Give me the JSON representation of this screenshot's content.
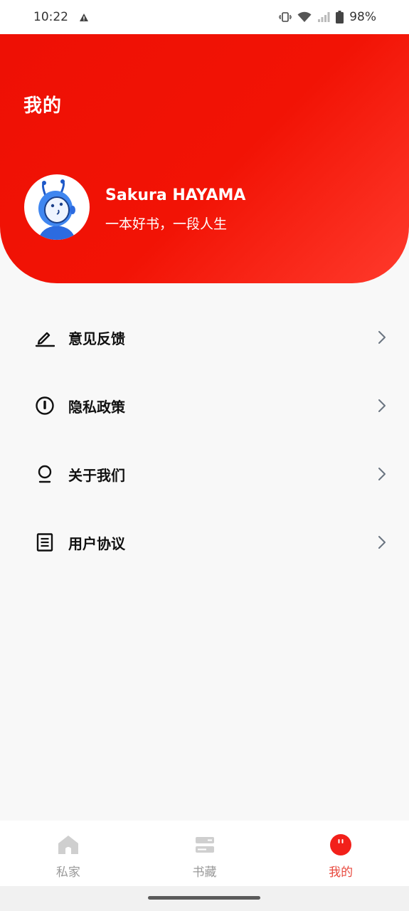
{
  "status_bar": {
    "time": "10:22",
    "battery": "98%",
    "icons": [
      "alert-icon",
      "vibrate-icon",
      "wifi-icon",
      "signal-icon",
      "battery-icon"
    ]
  },
  "header": {
    "title": "我的",
    "user_name": "Sakura HAYAMA",
    "motto": "一本好书，一段人生",
    "gradient_colors": [
      "#ee1005",
      "#ff3a2c"
    ]
  },
  "menu": {
    "items": [
      {
        "label": "意见反馈",
        "icon": "pencil-icon"
      },
      {
        "label": "隐私政策",
        "icon": "info-circle-icon"
      },
      {
        "label": "关于我们",
        "icon": "user-icon"
      },
      {
        "label": "用户协议",
        "icon": "document-icon"
      }
    ]
  },
  "bottom_nav": {
    "items": [
      {
        "label": "私家",
        "icon": "home-icon",
        "active": false
      },
      {
        "label": "书藏",
        "icon": "library-icon",
        "active": false
      },
      {
        "label": "我的",
        "icon": "profile-icon",
        "active": true
      }
    ],
    "active_color": "#e84a3f",
    "inactive_color": "#999999"
  }
}
